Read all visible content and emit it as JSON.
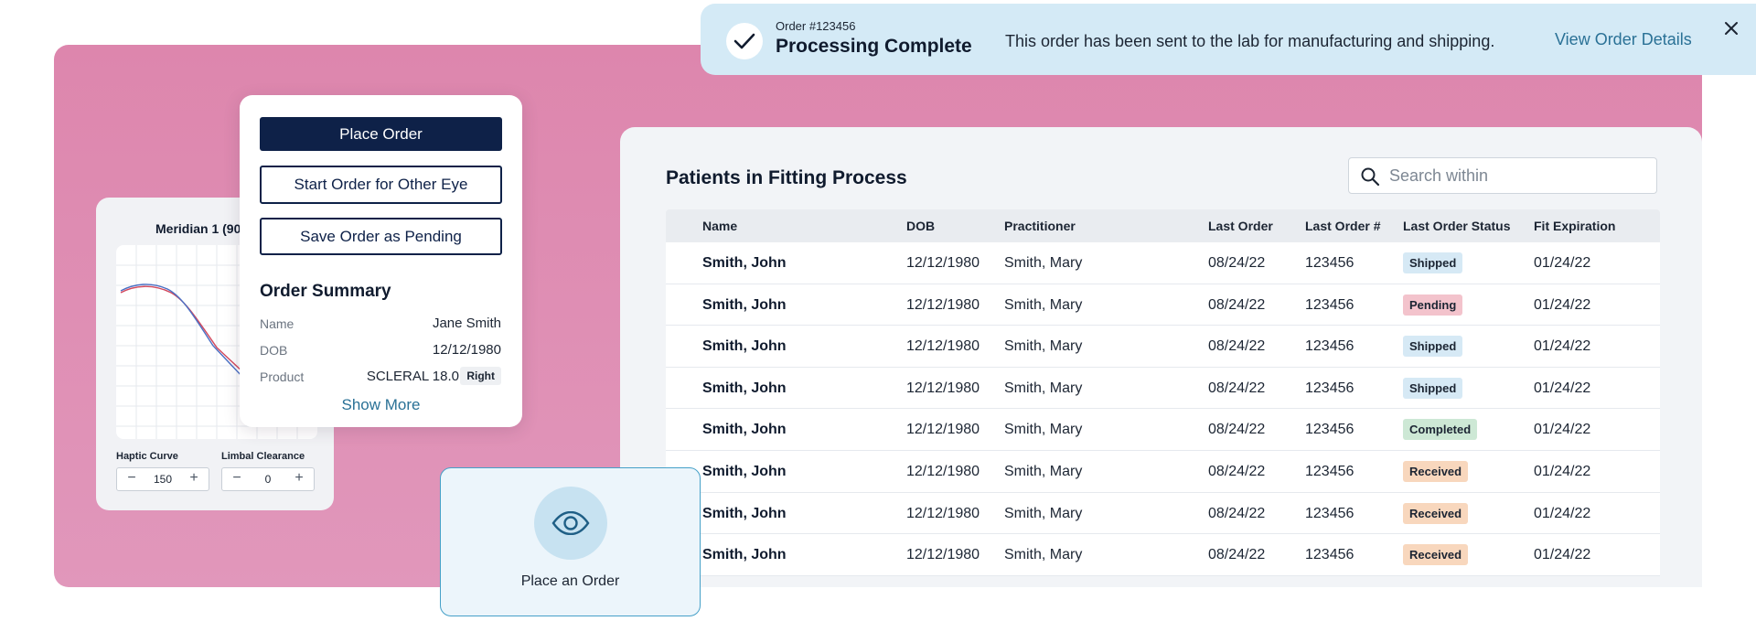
{
  "toast": {
    "order_number": "Order #123456",
    "title": "Processing Complete",
    "message": "This order has been sent to the lab for manufacturing and shipping.",
    "link": "View Order Details",
    "check_icon": "checkmark-icon",
    "close_icon": "close-icon"
  },
  "patients": {
    "title": "Patients in Fitting Process",
    "search_placeholder": "Search within",
    "columns": [
      "Name",
      "DOB",
      "Practitioner",
      "Last Order",
      "Last Order #",
      "Last Order Status",
      "Fit Expiration"
    ],
    "rows": [
      {
        "name": "Smith, John",
        "dob": "12/12/1980",
        "practitioner": "Smith, Mary",
        "last_order": "08/24/22",
        "order_no": "123456",
        "status": "Shipped",
        "fit_exp": "01/24/22"
      },
      {
        "name": "Smith, John",
        "dob": "12/12/1980",
        "practitioner": "Smith, Mary",
        "last_order": "08/24/22",
        "order_no": "123456",
        "status": "Pending",
        "fit_exp": "01/24/22"
      },
      {
        "name": "Smith, John",
        "dob": "12/12/1980",
        "practitioner": "Smith, Mary",
        "last_order": "08/24/22",
        "order_no": "123456",
        "status": "Shipped",
        "fit_exp": "01/24/22"
      },
      {
        "name": "Smith, John",
        "dob": "12/12/1980",
        "practitioner": "Smith, Mary",
        "last_order": "08/24/22",
        "order_no": "123456",
        "status": "Shipped",
        "fit_exp": "01/24/22"
      },
      {
        "name": "Smith, John",
        "dob": "12/12/1980",
        "practitioner": "Smith, Mary",
        "last_order": "08/24/22",
        "order_no": "123456",
        "status": "Completed",
        "fit_exp": "01/24/22"
      },
      {
        "name": "Smith, John",
        "dob": "12/12/1980",
        "practitioner": "Smith, Mary",
        "last_order": "08/24/22",
        "order_no": "123456",
        "status": "Received",
        "fit_exp": "01/24/22"
      },
      {
        "name": "Smith, John",
        "dob": "12/12/1980",
        "practitioner": "Smith, Mary",
        "last_order": "08/24/22",
        "order_no": "123456",
        "status": "Received",
        "fit_exp": "01/24/22"
      },
      {
        "name": "Smith, John",
        "dob": "12/12/1980",
        "practitioner": "Smith, Mary",
        "last_order": "08/24/22",
        "order_no": "123456",
        "status": "Received",
        "fit_exp": "01/24/22"
      }
    ],
    "status_colors": {
      "Shipped": "#d6e9f5",
      "Pending": "#f3c3cc",
      "Completed": "#cde8d5",
      "Received": "#f8d7bd"
    }
  },
  "meridian": {
    "title": "Meridian 1 (90",
    "haptic_label": "Haptic Curve",
    "haptic_value": "150",
    "limbal_label": "Limbal Clearance",
    "limbal_value": "0"
  },
  "order_card": {
    "place_order": "Place Order",
    "start_other_eye": "Start Order for Other Eye",
    "save_pending": "Save Order as Pending",
    "summary_title": "Order Summary",
    "name_label": "Name",
    "name_value": "Jane Smith",
    "dob_label": "DOB",
    "dob_value": "12/12/1980",
    "product_label": "Product",
    "product_value": "SCLERAL 18.0",
    "side": "Right",
    "show_more": "Show More"
  },
  "place_card": {
    "label": "Place an Order",
    "icon": "eye-icon"
  },
  "colors": {
    "background_pink": "#dd86ad",
    "navy": "#0e2148",
    "link_blue": "#2a7196",
    "toast_bg": "#d4eaf6"
  }
}
